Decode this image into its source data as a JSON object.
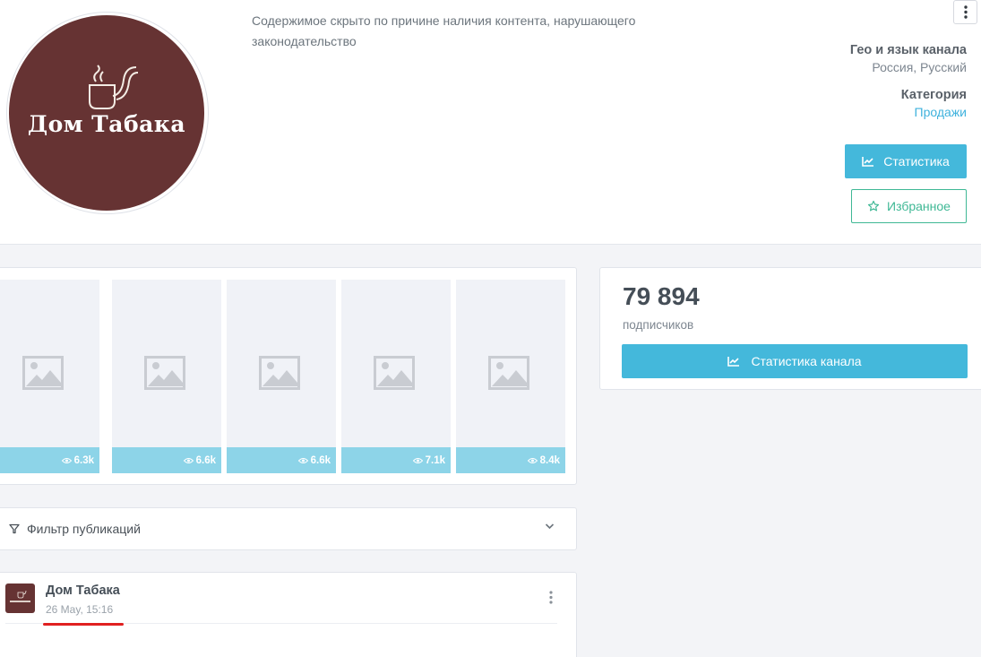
{
  "channel": {
    "logo_text": "Дом Табака",
    "description": "Содержимое скрыто по причине наличия контента, нарушающего законодательство"
  },
  "meta": {
    "geo_label": "Гео и язык канала",
    "geo_value": "Россия, Русский",
    "category_label": "Категория",
    "category_value": "Продажи"
  },
  "buttons": {
    "stats": "Статистика",
    "favorite": "Избранное",
    "channel_stats": "Статистика канала"
  },
  "gallery": {
    "items": [
      {
        "views": "6.3k"
      },
      {
        "views": "6.6k"
      },
      {
        "views": "6.6k"
      },
      {
        "views": "7.1k"
      },
      {
        "views": "8.4k"
      }
    ]
  },
  "subscribers": {
    "count": "79 894",
    "label": "подписчиков"
  },
  "filter": {
    "label": "Фильтр публикаций"
  },
  "post": {
    "author": "Дом Табака",
    "date": "26 May, 15:16"
  },
  "colors": {
    "accent": "#44b8db",
    "favorite": "#3fb895",
    "logo_bg": "#663333",
    "highlight": "#e02020"
  }
}
